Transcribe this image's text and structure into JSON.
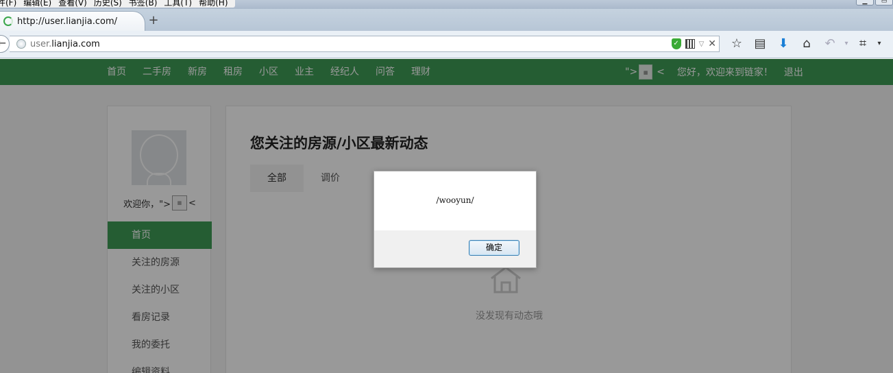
{
  "browser": {
    "menu": [
      "件(F)",
      "编辑(E)",
      "查看(V)",
      "历史(S)",
      "书签(B)",
      "工具(T)",
      "帮助(H)"
    ],
    "tab_title": "http://user.lianjia.com/",
    "new_tab": "+",
    "url_prefix": "user.",
    "url_domain": "lianjia.com",
    "back_glyph": "←",
    "icons": [
      "star-icon",
      "reading-list-icon",
      "download-icon",
      "home-icon",
      "undo-icon",
      "crop-icon",
      "menu-arrow-icon"
    ]
  },
  "site": {
    "nav": [
      "首页",
      "二手房",
      "新房",
      "租房",
      "小区",
      "业主",
      "经纪人",
      "问答",
      "理财"
    ],
    "nav_right_prefix": "\">",
    "nav_right_suffix": "<",
    "greeting": "您好，欢迎来到链家！",
    "logout": "退出",
    "brand_color": "#3f9c55"
  },
  "sidebar": {
    "welcome_prefix": "欢迎你，\">",
    "welcome_suffix": "<",
    "items": [
      "首页",
      "关注的房源",
      "关注的小区",
      "看房记录",
      "我的委托",
      "编辑资料"
    ]
  },
  "main": {
    "title": "您关注的房源/小区最新动态",
    "tabs": [
      "全部",
      "调价"
    ],
    "empty_text": "没发现有动态哦"
  },
  "dialog": {
    "message": "/wooyun/",
    "ok_label": "确定"
  }
}
